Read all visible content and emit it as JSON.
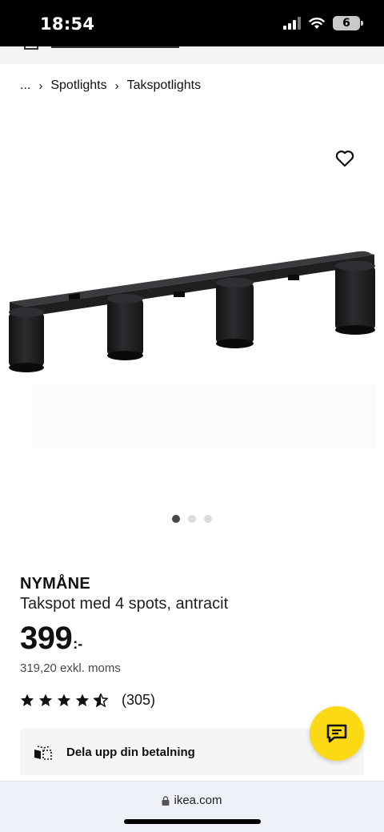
{
  "status": {
    "time": "18:54",
    "battery": "6"
  },
  "breadcrumb": {
    "ellipsis": "...",
    "items": [
      "Spotlights",
      "Takspotlights"
    ]
  },
  "product": {
    "name": "NYMÅNE",
    "description": "Takspot med 4 spots, antracit",
    "price": "399",
    "price_suffix": ":-",
    "price_excl": "319,20 exkl. moms",
    "rating": {
      "stars": 4.5,
      "count": "(305)"
    }
  },
  "carousel": {
    "total": 3,
    "active": 1
  },
  "payment": {
    "label": "Dela upp din betalning"
  },
  "browser": {
    "url": "ikea.com"
  },
  "colors": {
    "accent": "#fbd914",
    "fixture": "#1e1f21",
    "text": "#111111"
  }
}
